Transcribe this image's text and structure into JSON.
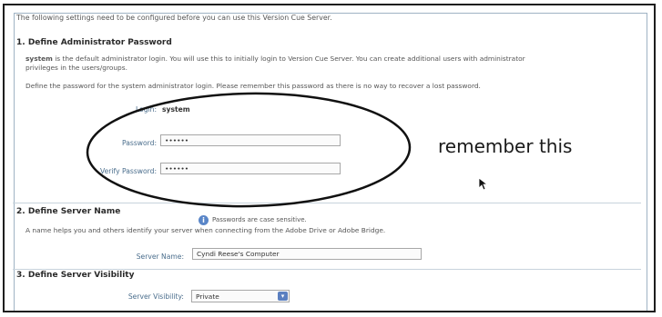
{
  "intro": "The following settings need to be configured before you can use this Version Cue Server.",
  "section1": {
    "heading": "1. Define Administrator Password",
    "system_user": "system",
    "desc1_rest": " is the default administrator login. You will use this to initially login to Version Cue Server. You can create additional users with administrator",
    "desc1_line2": "privileges in the users/groups.",
    "desc2": "Define the password for the system administrator login. Please remember this password as there is no way to recover a lost password.",
    "login_label": "Login:",
    "login_value": "system",
    "password_label": "Password:",
    "password_value": "••••••",
    "verify_label": "Verify Password:",
    "verify_value": "••••••",
    "case_note": "Passwords are case sensitive."
  },
  "section2": {
    "heading": "2. Define Server Name",
    "desc": "A name helps you and others identify your server when connecting from the Adobe Drive or Adobe Bridge.",
    "server_name_label": "Server Name:",
    "server_name_value": "Cyndi Reese's Computer"
  },
  "section3": {
    "heading": "3. Define Server Visibility",
    "visibility_label": "Server Visibility:",
    "visibility_value": "Private"
  },
  "annotation": "remember this"
}
